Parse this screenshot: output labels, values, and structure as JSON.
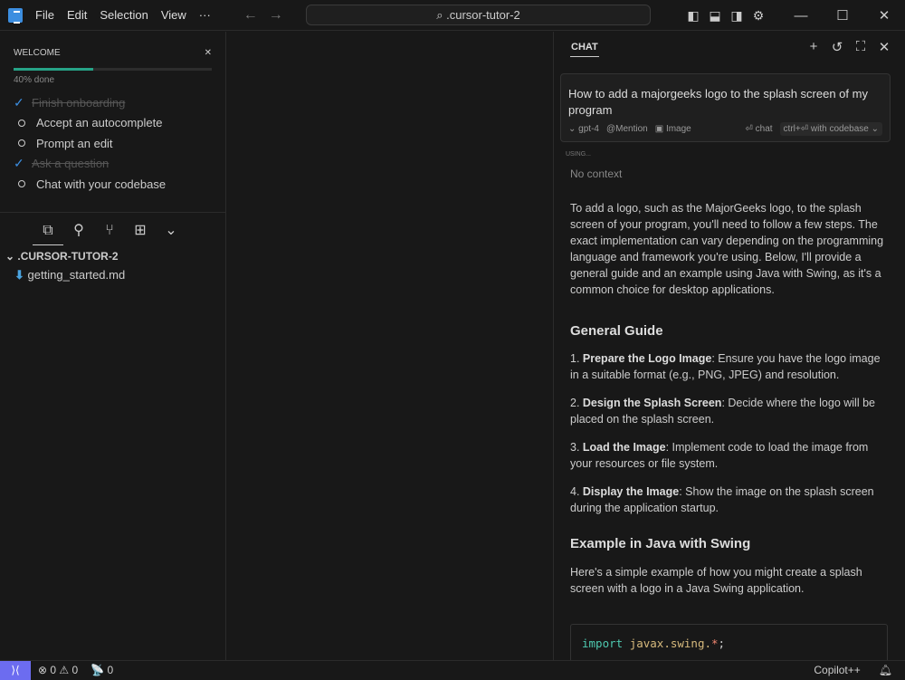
{
  "titlebar": {
    "menus": [
      "File",
      "Edit",
      "Selection",
      "View"
    ],
    "more": "···",
    "search": ".cursor-tutor-2"
  },
  "welcome": {
    "title": "WELCOME",
    "progress_percent": 40,
    "progress_label": "40% done",
    "tasks": [
      {
        "label": "Finish onboarding",
        "done": true
      },
      {
        "label": "Accept an autocomplete",
        "done": false
      },
      {
        "label": "Prompt an edit",
        "done": false
      },
      {
        "label": "Ask a question",
        "done": true
      },
      {
        "label": "Chat with your codebase",
        "done": false
      }
    ]
  },
  "explorer": {
    "folder": ".CURSOR-TUTOR-2",
    "files": [
      "getting_started.md"
    ]
  },
  "chat": {
    "tab": "CHAT",
    "query": "How to add a majorgeeks logo to the splash screen of my program",
    "model": "gpt-4",
    "mention": "Mention",
    "image": "Image",
    "chat_btn": "chat",
    "codebase_btn": "with codebase",
    "shortcut": "ctrl+⏎",
    "using": "USING...",
    "no_context": "No context",
    "intro": "To add a logo, such as the MajorGeeks logo, to the splash screen of your program, you'll need to follow a few steps. The exact implementation can vary depending on the programming language and framework you're using. Below, I'll provide a general guide and an example using Java with Swing, as it's a common choice for desktop applications.",
    "h1": "General Guide",
    "steps": [
      {
        "n": "1. ",
        "b": "Prepare the Logo Image",
        "t": ": Ensure you have the logo image in a suitable format (e.g., PNG, JPEG) and resolution."
      },
      {
        "n": "2. ",
        "b": "Design the Splash Screen",
        "t": ": Decide where the logo will be placed on the splash screen."
      },
      {
        "n": "3. ",
        "b": "Load the Image",
        "t": ": Implement code to load the image from your resources or file system."
      },
      {
        "n": "4. ",
        "b": "Display the Image",
        "t": ": Show the image on the splash screen during the application startup."
      }
    ],
    "h2": "Example in Java with Swing",
    "p2": "Here's a simple example of how you might create a splash screen with a logo in a Java Swing application.",
    "code": {
      "kw": "import",
      "pkg": "javax.swing.",
      "star": "*",
      "end": ";"
    }
  },
  "status": {
    "errors": "0",
    "warnings": "0",
    "ports": "0",
    "copilot": "Copilot++"
  }
}
